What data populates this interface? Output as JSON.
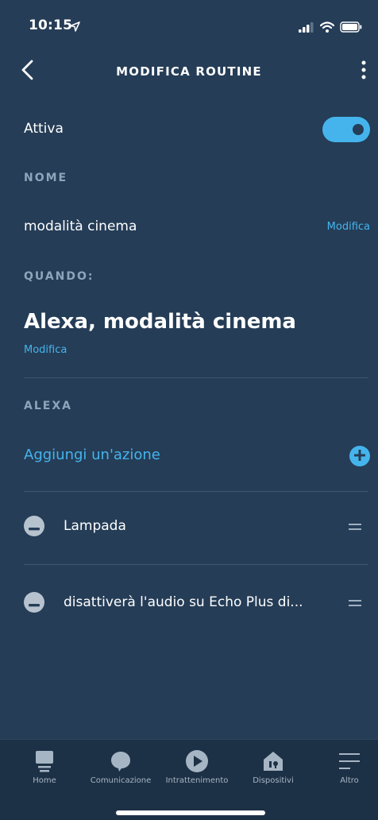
{
  "status_bar": {
    "time": "10:15"
  },
  "nav": {
    "title": "MODIFICA ROUTINE"
  },
  "active": {
    "label": "Attiva",
    "enabled": true
  },
  "name_section": {
    "label": "NOME",
    "value": "modalità cinema",
    "edit_label": "Modifica"
  },
  "when_section": {
    "label": "QUANDO:",
    "phrase": "Alexa, modalità cinema",
    "edit_label": "Modifica"
  },
  "alexa_section": {
    "label": "ALEXA",
    "add_action_label": "Aggiungi un'azione",
    "actions": [
      {
        "text": "Lampada"
      },
      {
        "text": "disattiverà l'audio su Echo Plus  di..."
      }
    ]
  },
  "tab_bar": {
    "tabs": [
      {
        "label": "Home",
        "icon": "home-icon"
      },
      {
        "label": "Comunicazione",
        "icon": "chat-bubble-icon"
      },
      {
        "label": "Intrattenimento",
        "icon": "play-icon"
      },
      {
        "label": "Dispositivi",
        "icon": "devices-house-icon"
      },
      {
        "label": "Altro",
        "icon": "menu-lines-icon"
      }
    ]
  },
  "colors": {
    "background": "#253d57",
    "accent": "#45b4ec",
    "section_label": "#8ea5bc",
    "tab_bar": "#1d3146"
  }
}
